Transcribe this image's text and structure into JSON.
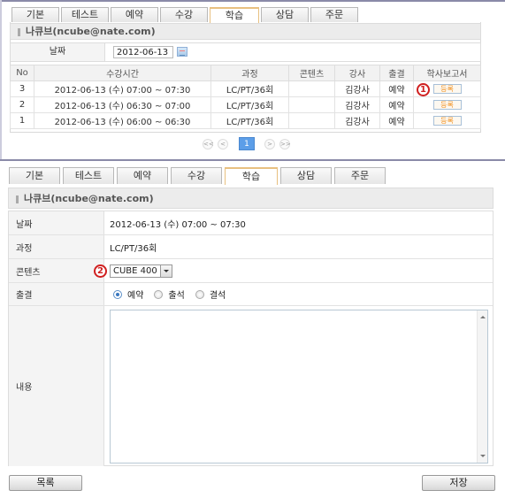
{
  "tabs": [
    {
      "label": "기본",
      "active": false
    },
    {
      "label": "테스트",
      "active": false
    },
    {
      "label": "예약",
      "active": false
    },
    {
      "label": "수강",
      "active": false
    },
    {
      "label": "학습",
      "active": true
    },
    {
      "label": "상담",
      "active": false
    },
    {
      "label": "주문",
      "active": false
    }
  ],
  "list_view": {
    "section_title": "나큐브(ncube@nate.com)",
    "date_label": "날짜",
    "date_value": "2012-06-13",
    "table": {
      "headers": [
        "No",
        "수강시간",
        "과정",
        "콘텐츠",
        "강사",
        "출결",
        "학사보고서"
      ],
      "rows": [
        {
          "no": "3",
          "time": "2012-06-13 (수) 07:00 ~ 07:30",
          "course": "LC/PT/36회",
          "content": "",
          "teacher": "김강사",
          "attendance": "예약",
          "action": "등록"
        },
        {
          "no": "2",
          "time": "2012-06-13 (수) 06:30 ~ 07:00",
          "course": "LC/PT/36회",
          "content": "",
          "teacher": "김강사",
          "attendance": "예약",
          "action": "등록"
        },
        {
          "no": "1",
          "time": "2012-06-13 (수) 06:00 ~ 06:30",
          "course": "LC/PT/36회",
          "content": "",
          "teacher": "김강사",
          "attendance": "예약",
          "action": "등록"
        }
      ]
    },
    "pagination": {
      "first": "<<",
      "prev": "<",
      "current": "1",
      "next": ">",
      "last": ">>"
    },
    "marker": "1"
  },
  "detail_view": {
    "section_title": "나큐브(ncube@nate.com)",
    "fields": {
      "date_label": "날짜",
      "date_value": "2012-06-13 (수) 07:00 ~ 07:30",
      "course_label": "과정",
      "course_value": "LC/PT/36회",
      "content_label": "콘텐츠",
      "content_selected": "CUBE 400",
      "attendance_label": "출결",
      "attendance_options": [
        {
          "label": "예약",
          "checked": true
        },
        {
          "label": "출석",
          "checked": false
        },
        {
          "label": "결석",
          "checked": false
        }
      ],
      "notes_label": "내용",
      "notes_value": ""
    },
    "marker": "2",
    "buttons": {
      "list": "목록",
      "save": "저장"
    }
  },
  "colors": {
    "active_tab_accent": "#f0a030",
    "attendance_text": "#9ab92c",
    "register_button_text": "#f09020",
    "marker": "#d02020",
    "pager_current": "#5c9ee8"
  }
}
